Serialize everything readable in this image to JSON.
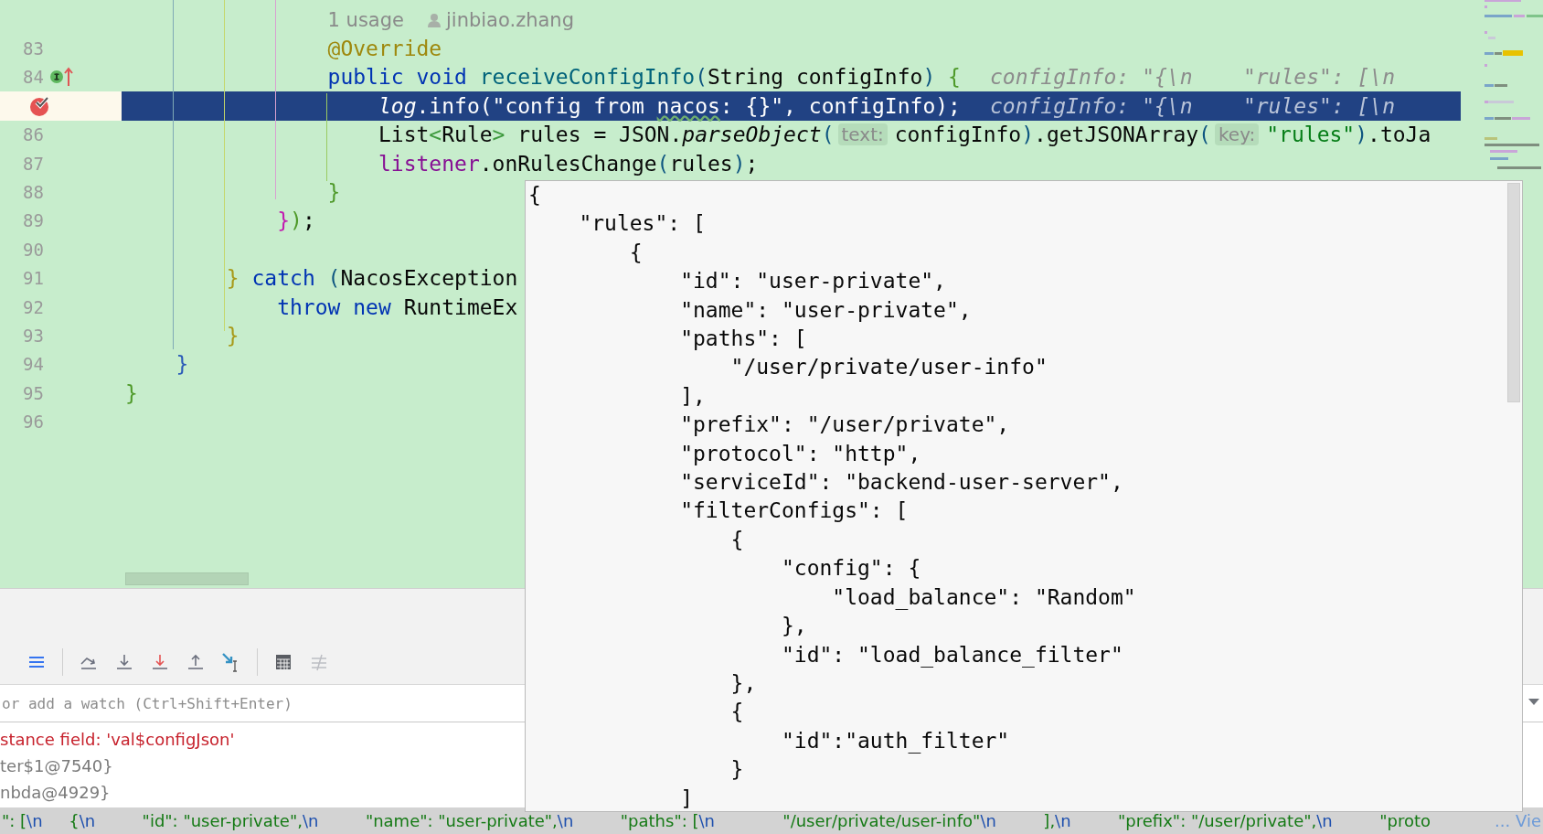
{
  "editor": {
    "lines": [
      {
        "kind": "inlay",
        "breakpoint": false,
        "current": false,
        "interface_method": false,
        "tokens": [
          {
            "kind": "usages",
            "text": "                1 usage"
          },
          {
            "kind": "author",
            "text": "jinbiao.zhang"
          }
        ]
      },
      {
        "kind": "code",
        "number": "83",
        "breakpoint": false,
        "current": false,
        "interface_method": false,
        "tokens": [
          {
            "kind": "annotation",
            "text": "                @Override"
          }
        ]
      },
      {
        "kind": "code",
        "number": "84",
        "breakpoint": false,
        "current": false,
        "interface_method": true,
        "tokens": [
          {
            "kind": "keyword",
            "text": "                public void "
          },
          {
            "kind": "method",
            "text": "receiveConfigInfo"
          },
          {
            "kind": "paren",
            "text": "("
          },
          {
            "kind": "plain",
            "text": "String configInfo"
          },
          {
            "kind": "paren",
            "text": ") "
          },
          {
            "kind": "brace-green",
            "text": "{"
          },
          {
            "kind": "inline-value",
            "text": "configInfo: \"{\\n    \"rules\": [\\n"
          }
        ]
      },
      {
        "kind": "code",
        "breakpoint": true,
        "current": true,
        "interface_method": false,
        "tokens": [
          {
            "kind": "static-field",
            "text": "                    log"
          },
          {
            "kind": "plain",
            "text": ".info(\"config from "
          },
          {
            "kind": "typo",
            "text": "nacos"
          },
          {
            "kind": "plain",
            "text": ": {}\", configInfo);"
          },
          {
            "kind": "inline-value",
            "text": "configInfo: \"{\\n    \"rules\": [\\n"
          }
        ]
      },
      {
        "kind": "code",
        "number": "86",
        "breakpoint": false,
        "current": false,
        "interface_method": false,
        "tokens": [
          {
            "kind": "plain",
            "text": "                    List"
          },
          {
            "kind": "generic",
            "text": "<"
          },
          {
            "kind": "plain",
            "text": "Rule"
          },
          {
            "kind": "generic",
            "text": ">"
          },
          {
            "kind": "plain",
            "text": " rules = JSON."
          },
          {
            "kind": "static-method",
            "text": "parseObject"
          },
          {
            "kind": "paren",
            "text": "("
          },
          {
            "kind": "param-hint",
            "text": "text:"
          },
          {
            "kind": "plain",
            "text": "configInfo"
          },
          {
            "kind": "paren",
            "text": ")"
          },
          {
            "kind": "plain",
            "text": ".getJSONArray"
          },
          {
            "kind": "paren",
            "text": "("
          },
          {
            "kind": "param-hint",
            "text": "key:"
          },
          {
            "kind": "string",
            "text": "\"rules\""
          },
          {
            "kind": "paren",
            "text": ")"
          },
          {
            "kind": "plain",
            "text": ".toJa"
          }
        ]
      },
      {
        "kind": "code",
        "number": "87",
        "breakpoint": false,
        "current": false,
        "interface_method": false,
        "tokens": [
          {
            "kind": "field",
            "text": "                    listener"
          },
          {
            "kind": "plain",
            "text": ".onRulesChange"
          },
          {
            "kind": "paren",
            "text": "("
          },
          {
            "kind": "plain",
            "text": "rules"
          },
          {
            "kind": "paren",
            "text": ")"
          },
          {
            "kind": "plain",
            "text": ";"
          }
        ]
      },
      {
        "kind": "code",
        "number": "88",
        "breakpoint": false,
        "current": false,
        "interface_method": false,
        "tokens": [
          {
            "kind": "brace-green",
            "text": "                }"
          }
        ]
      },
      {
        "kind": "code",
        "number": "89",
        "breakpoint": false,
        "current": false,
        "interface_method": false,
        "tokens": [
          {
            "kind": "brace-magenta",
            "text": "            }"
          },
          {
            "kind": "brace-green",
            "text": ")"
          },
          {
            "kind": "plain",
            "text": ";"
          }
        ]
      },
      {
        "kind": "code",
        "number": "90",
        "breakpoint": false,
        "current": false,
        "interface_method": false
      },
      {
        "kind": "code",
        "number": "91",
        "breakpoint": false,
        "current": false,
        "interface_method": false,
        "tokens": [
          {
            "kind": "brace-gold",
            "text": "        }"
          },
          {
            "kind": "keyword",
            "text": " catch "
          },
          {
            "kind": "paren",
            "text": "("
          },
          {
            "kind": "plain",
            "text": "NacosException"
          }
        ]
      },
      {
        "kind": "code",
        "number": "92",
        "breakpoint": false,
        "current": false,
        "interface_method": false,
        "tokens": [
          {
            "kind": "keyword",
            "text": "            throw new "
          },
          {
            "kind": "plain",
            "text": "RuntimeEx"
          }
        ]
      },
      {
        "kind": "code",
        "number": "93",
        "breakpoint": false,
        "current": false,
        "interface_method": false,
        "tokens": [
          {
            "kind": "brace-gold",
            "text": "        }"
          }
        ]
      },
      {
        "kind": "code",
        "number": "94",
        "breakpoint": false,
        "current": false,
        "interface_method": false,
        "tokens": [
          {
            "kind": "brace-blue",
            "text": "    }"
          }
        ]
      },
      {
        "kind": "code",
        "number": "95",
        "breakpoint": false,
        "current": false,
        "interface_method": false,
        "tokens": [
          {
            "kind": "brace-green",
            "text": "}"
          }
        ]
      },
      {
        "kind": "code",
        "number": "96",
        "breakpoint": false,
        "current": false,
        "interface_method": false
      }
    ]
  },
  "value_popup": {
    "lines": [
      "{",
      "    \"rules\": [",
      "        {",
      "            \"id\": \"user-private\",",
      "            \"name\": \"user-private\",",
      "            \"paths\": [",
      "                \"/user/private/user-info\"",
      "            ],",
      "            \"prefix\": \"/user/private\",",
      "            \"protocol\": \"http\",",
      "            \"serviceId\": \"backend-user-server\",",
      "            \"filterConfigs\": [",
      "                {",
      "                    \"config\": {",
      "                        \"load_balance\": \"Random\"",
      "                    },",
      "                    \"id\": \"load_balance_filter\"",
      "                },",
      "                {",
      "                    \"id\":\"auth_filter\"",
      "                }",
      "            ]"
    ]
  },
  "debugger": {
    "toolbar": [
      {
        "kind": "layout",
        "disabled": false
      },
      {
        "kind": "separator"
      },
      {
        "kind": "step-over",
        "disabled": false
      },
      {
        "kind": "step-into",
        "disabled": false
      },
      {
        "kind": "force-step-into",
        "disabled": false
      },
      {
        "kind": "step-out",
        "disabled": false
      },
      {
        "kind": "run-to-cursor",
        "disabled": false
      },
      {
        "kind": "separator"
      },
      {
        "kind": "evaluate",
        "disabled": false
      },
      {
        "kind": "trace",
        "disabled": true
      }
    ],
    "watch_field": {
      "placeholder": "or add a watch (Ctrl+Shift+Enter)"
    },
    "variables": [
      {
        "kind": "error",
        "text": "stance field: 'val$configJson'"
      },
      {
        "kind": "value",
        "text": "ter$1@7540}"
      },
      {
        "kind": "value",
        "text": "nbda@4929}"
      }
    ]
  },
  "status_preview": {
    "segments": [
      {
        "kind": "text",
        "text": "\": ["
      },
      {
        "kind": "escape",
        "text": "\\n"
      },
      {
        "kind": "text",
        "text": "     {"
      },
      {
        "kind": "escape",
        "text": "\\n"
      },
      {
        "kind": "text",
        "text": "         \"id\": \"user-private\","
      },
      {
        "kind": "escape",
        "text": "\\n"
      },
      {
        "kind": "text",
        "text": "         \"name\": \"user-private\","
      },
      {
        "kind": "escape",
        "text": "\\n"
      },
      {
        "kind": "text",
        "text": "         \"paths\": ["
      },
      {
        "kind": "escape",
        "text": "\\n"
      },
      {
        "kind": "text",
        "text": "             \"/user/private/user-info\""
      },
      {
        "kind": "escape",
        "text": "\\n"
      },
      {
        "kind": "text",
        "text": "         ],"
      },
      {
        "kind": "escape",
        "text": "\\n"
      },
      {
        "kind": "text",
        "text": "         \"prefix\": \"/user/private\","
      },
      {
        "kind": "escape",
        "text": "\\n"
      },
      {
        "kind": "text",
        "text": "         \"proto"
      }
    ],
    "link": "... Vie"
  }
}
